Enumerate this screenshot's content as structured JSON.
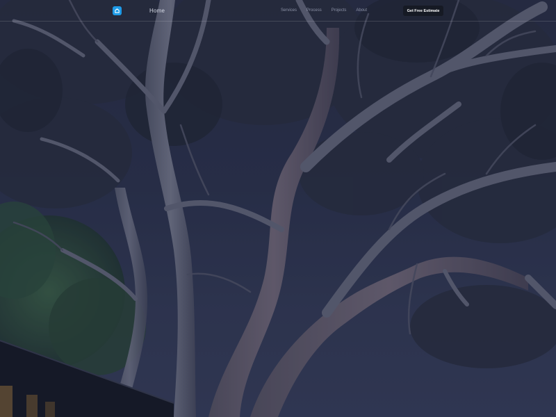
{
  "nav": {
    "home_label": "Home",
    "links": [
      {
        "label": "Services"
      },
      {
        "label": "Process"
      },
      {
        "label": "Projects"
      },
      {
        "label": "About"
      }
    ],
    "cta_label": "Get Free Estimate"
  },
  "hero": {
    "image": "eucalyptus-tree-dusk-photo"
  },
  "logo": {
    "icon": "house-icon",
    "color": "#1e9be8"
  }
}
